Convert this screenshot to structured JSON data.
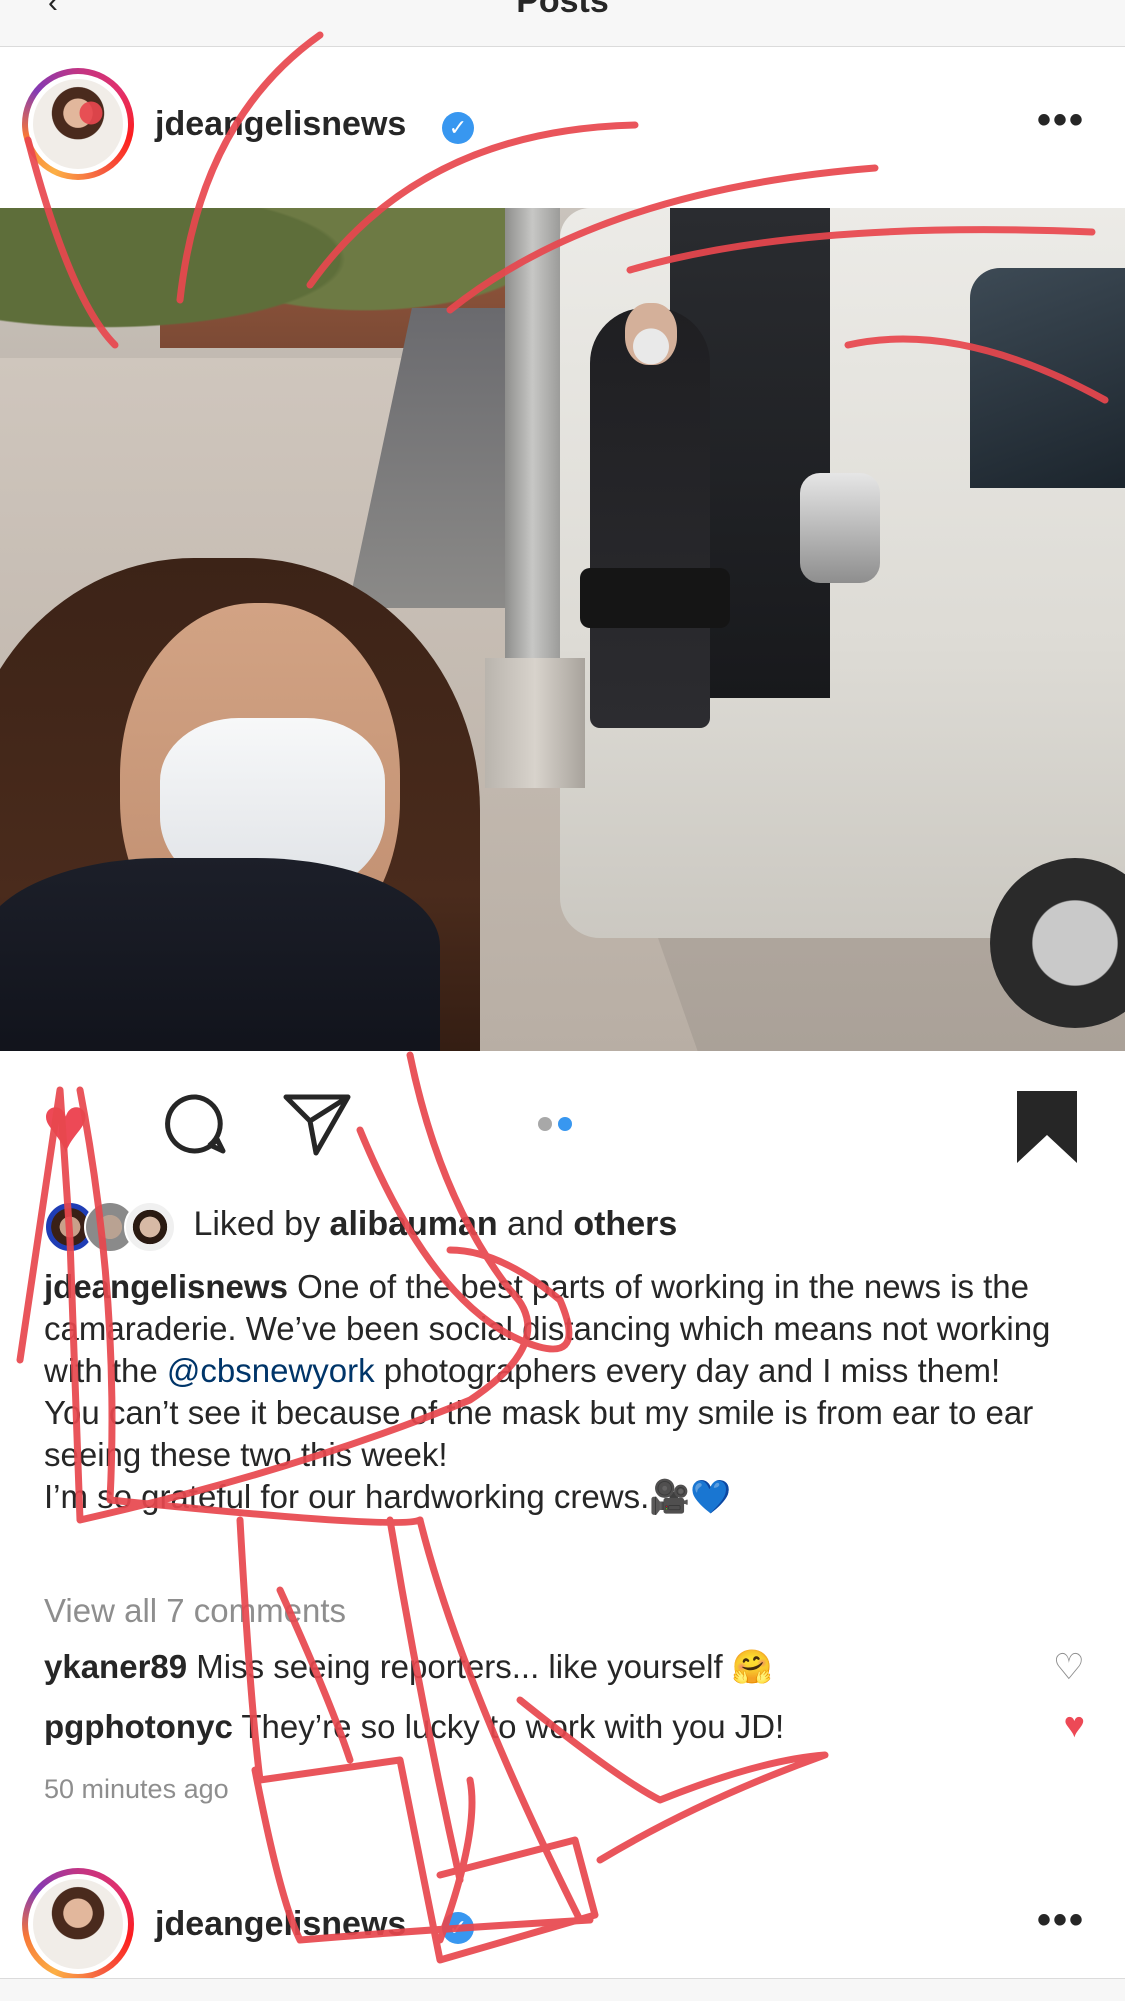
{
  "nav": {
    "title": "Posts",
    "back_glyph": "‹"
  },
  "posts": [
    {
      "username": "jdeangelisnews",
      "verified_glyph": "✓",
      "more_glyph": "•••"
    },
    {
      "username": "jdeangelisnews",
      "verified_glyph": "✓",
      "more_glyph": "•••"
    }
  ],
  "actions": {
    "like_glyph": "♥",
    "carousel_count": 2,
    "carousel_active_index": 1
  },
  "likes": {
    "prefix": "Liked by ",
    "user": "alibauman",
    "middle": " and ",
    "suffix": "others"
  },
  "caption": {
    "username": "jdeangelisnews",
    "text_1": " One of the best parts of working in the news is the camaraderie. We’ve been social distancing which means not working with the ",
    "mention": "@cbsnewyork",
    "text_2": " photographers every day and I miss them!",
    "line_2": "You can’t see it because of the mask but my smile is from ear to ear seeing these two this week!",
    "line_3": "I’m so grateful for our hardworking crews.🎥💙"
  },
  "view_comments": "View all 7 comments",
  "comments": [
    {
      "username": "ykaner89",
      "text": " Miss seeing reporters... like yourself 🤗",
      "liked": false,
      "heart_glyph": "♡"
    },
    {
      "username": "pgphotonyc",
      "text": " They’re so lucky to work with you JD!",
      "liked": true,
      "heart_glyph": "♥"
    }
  ],
  "timestamp": "50 minutes ago",
  "colors": {
    "like": "#ed4956",
    "verified": "#3897f0",
    "carousel_active": "#3897f0",
    "carousel_inactive": "#a8a8a8",
    "scribble": "#e8474e",
    "mention": "#003569"
  }
}
